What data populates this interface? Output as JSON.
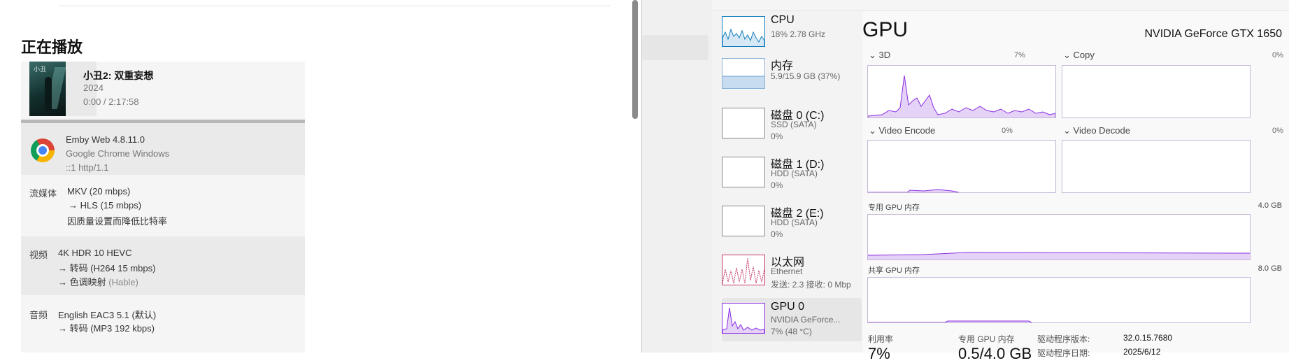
{
  "emby": {
    "heading": "正在播放",
    "poster_title": "小丑",
    "movie": {
      "title": "小丑2: 双重妄想",
      "year": "2024",
      "time": "0:00 / 2:17:58"
    },
    "client": {
      "app": "Emby Web 4.8.11.0",
      "browser": "Google Chrome Windows",
      "address": "::1 http/1.1"
    },
    "stream": {
      "label": "流媒体",
      "source": "MKV (20 mbps)",
      "target": "→  HLS (15 mbps)",
      "reason": "因质量设置而降低比特率"
    },
    "video": {
      "label": "视频",
      "source": "4K HDR 10 HEVC",
      "transcode_prefix": "→  转码",
      "transcode_detail": "(H264 15 mbps)",
      "tonemap_prefix": "→  色调映射",
      "tonemap_detail": "(Hable)"
    },
    "audio": {
      "label": "音频",
      "source": "English EAC3 5.1 (默认)",
      "transcode": "→  转码 (MP3 192 kbps)"
    }
  },
  "taskmgr": {
    "items": [
      {
        "name": "CPU",
        "sub1": "18% 2.78 GHz",
        "sub2": "",
        "sub3": ""
      },
      {
        "name": "内存",
        "sub1": "5.9/15.9 GB (37%)",
        "sub2": "",
        "sub3": ""
      },
      {
        "name": "磁盘 0 (C:)",
        "sub1": "SSD (SATA)",
        "sub2": "0%",
        "sub3": ""
      },
      {
        "name": "磁盘 1 (D:)",
        "sub1": "HDD (SATA)",
        "sub2": "0%",
        "sub3": ""
      },
      {
        "name": "磁盘 2 (E:)",
        "sub1": "HDD (SATA)",
        "sub2": "0%",
        "sub3": ""
      },
      {
        "name": "以太网",
        "sub1": "Ethernet",
        "sub2": "发送: 2.3  接收: 0 Mbp",
        "sub3": ""
      },
      {
        "name": "GPU 0",
        "sub1": "NVIDIA GeForce...",
        "sub2": "7% (48 °C)",
        "sub3": ""
      }
    ],
    "gpu": {
      "title": "GPU",
      "model": "NVIDIA GeForce GTX 1650",
      "engines": [
        {
          "name": "3D",
          "percent": "7%"
        },
        {
          "name": "Copy",
          "percent": "0%"
        },
        {
          "name": "Video Encode",
          "percent": "0%"
        },
        {
          "name": "Video Decode",
          "percent": "0%"
        }
      ],
      "dedicated_label": "专用 GPU 内存",
      "dedicated_max": "4.0 GB",
      "shared_label": "共享 GPU 内存",
      "shared_max": "8.0 GB",
      "stats": {
        "util_label": "利用率",
        "util_value": "7%",
        "dedicated_label": "专用 GPU 内存",
        "dedicated_value": "0.5/4.0 GB",
        "driver_version_label": "驱动程序版本:",
        "driver_version_value": "32.0.15.7680",
        "driver_date_label": "驱动程序日期:",
        "driver_date_value": "2025/6/12"
      }
    }
  },
  "colors": {
    "gpu_line": "#8a2be2",
    "gpu_fill": "#e4d2f7",
    "cpu_line": "#117dbb",
    "mem_fill": "#c8dcf0",
    "net_line": "#c53a6b"
  }
}
